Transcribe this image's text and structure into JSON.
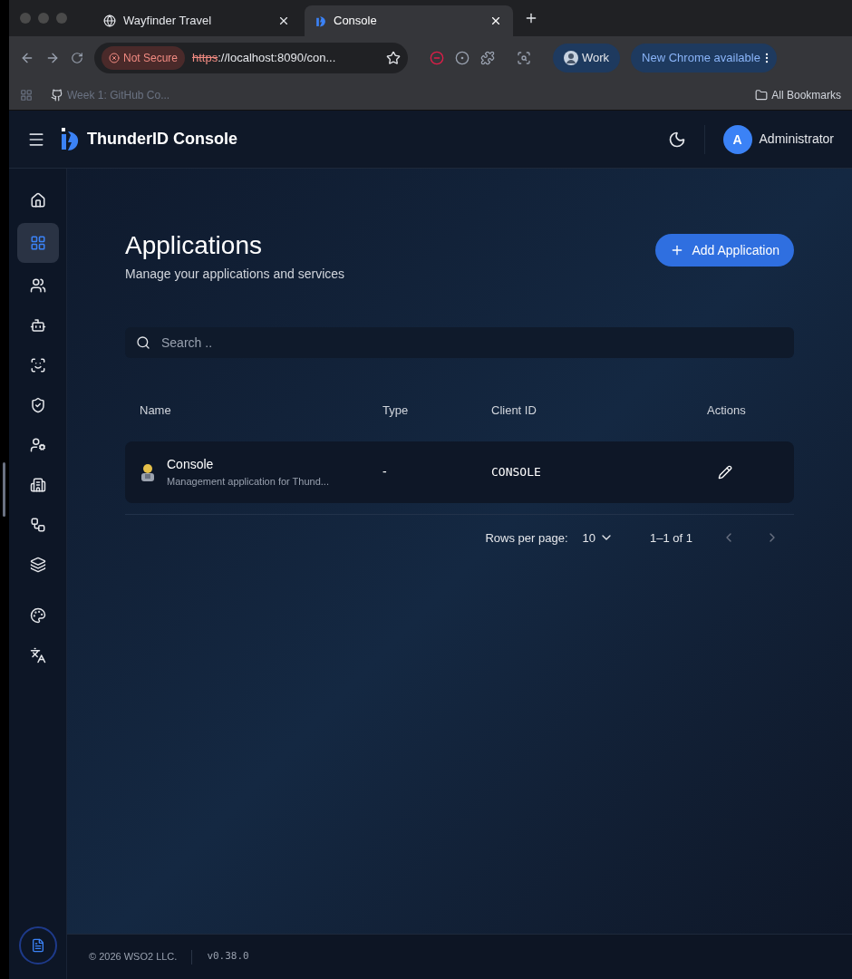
{
  "browser": {
    "tabs": [
      {
        "title": "Wayfinder Travel",
        "selected": false
      },
      {
        "title": "Console",
        "selected": true
      }
    ],
    "security": "Not Secure",
    "url_scheme": "https",
    "url_rest": "://localhost:8090/con...",
    "profile": "Work",
    "update": "New Chrome available",
    "bookmarks": [
      {
        "label": "Week 1: GitHub Co..."
      }
    ],
    "all_bookmarks": "All Bookmarks"
  },
  "header": {
    "brand": "ThunderID",
    "product": "Console",
    "user_initial": "A",
    "user_name": "Administrator"
  },
  "sidebar": {
    "items": [
      {
        "selected": false
      },
      {
        "selected": true
      },
      {
        "selected": false
      },
      {
        "selected": false
      },
      {
        "selected": false
      },
      {
        "selected": false
      },
      {
        "selected": false
      },
      {
        "selected": false
      },
      {
        "selected": false
      },
      {
        "selected": false
      },
      {
        "selected": false
      },
      {
        "selected": false
      }
    ]
  },
  "page": {
    "title": "Applications",
    "subtitle": "Manage your applications and services",
    "add_button": "Add Application",
    "search": {
      "placeholder": "Search .."
    }
  },
  "table": {
    "columns": [
      "Name",
      "Type",
      "Client ID",
      "Actions"
    ],
    "rows": [
      {
        "name": "Console",
        "description": "Management application for Thund...",
        "type": "-",
        "client_id": "CONSOLE"
      }
    ]
  },
  "pagination": {
    "rows_label": "Rows per page:",
    "rows_value": "10",
    "range": "1–1 of 1"
  },
  "footer": {
    "copyright": "© 2026 WSO2 LLC.",
    "version": "v0.38.0"
  }
}
